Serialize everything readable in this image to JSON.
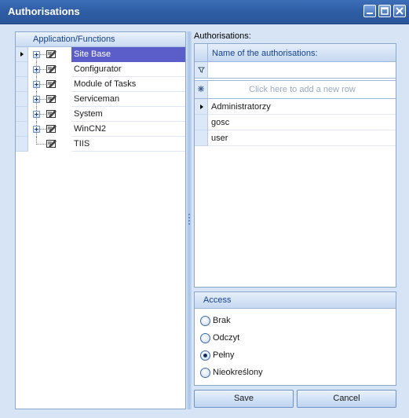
{
  "window": {
    "title": "Authorisations"
  },
  "left": {
    "header": "Application/Functions",
    "items": [
      {
        "label": "Site Base",
        "selected": true,
        "expandable": true
      },
      {
        "label": "Configurator",
        "selected": false,
        "expandable": true
      },
      {
        "label": "Module of Tasks",
        "selected": false,
        "expandable": true
      },
      {
        "label": "Serviceman",
        "selected": false,
        "expandable": true
      },
      {
        "label": "System",
        "selected": false,
        "expandable": true
      },
      {
        "label": "WinCN2",
        "selected": false,
        "expandable": true
      },
      {
        "label": "TIIS",
        "selected": false,
        "expandable": false
      }
    ]
  },
  "right": {
    "label": "Authorisations:",
    "grid": {
      "column": "Name of the authorisations:",
      "new_row_placeholder": "Click here to add a new row",
      "rows": [
        "Administratorzy",
        "gosc",
        "user"
      ],
      "current_row": 0
    }
  },
  "access": {
    "title": "Access",
    "options": [
      "Brak",
      "Odczyt",
      "Pełny",
      "Nieokreślony"
    ],
    "selected": "Pełny"
  },
  "buttons": {
    "save": "Save",
    "cancel": "Cancel"
  },
  "colors": {
    "title_bar": "#2f5ea6",
    "selection": "#5b5ec8",
    "panel_bg": "#d6e4f5"
  }
}
